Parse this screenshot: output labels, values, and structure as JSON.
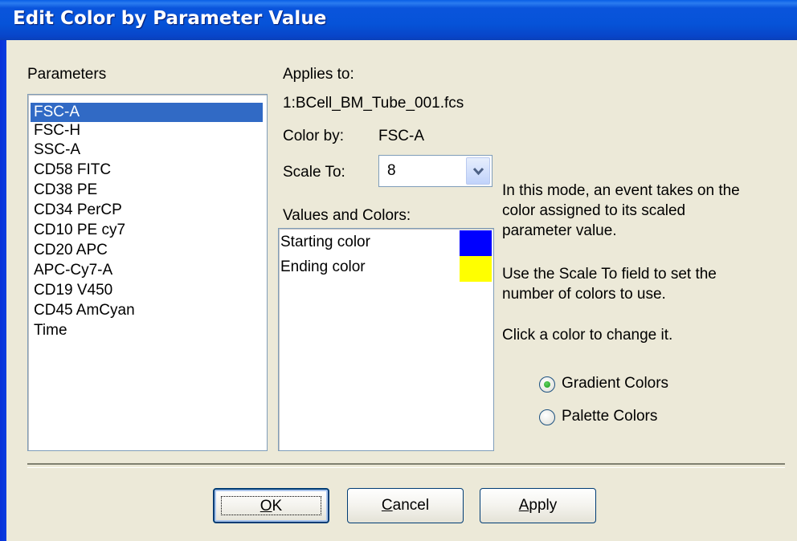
{
  "window": {
    "title": "Edit Color by Parameter Value"
  },
  "parameters": {
    "label": "Parameters",
    "items": [
      "FSC-A",
      "FSC-H",
      "SSC-A",
      "CD58 FITC",
      "CD38 PE",
      "CD34 PerCP",
      "CD10 PE cy7",
      "CD20 APC",
      "APC-Cy7-A",
      "CD19 V450",
      "CD45 AmCyan",
      "Time"
    ],
    "selected": "FSC-A"
  },
  "applies_to": {
    "label": "Applies to:",
    "value": "1:BCell_BM_Tube_001.fcs"
  },
  "color_by": {
    "label": "Color by:",
    "value": "FSC-A"
  },
  "scale_to": {
    "label": "Scale To:",
    "value": "8"
  },
  "values_colors": {
    "label": "Values and Colors:",
    "rows": [
      {
        "label": "Starting color",
        "color": "#0000ff"
      },
      {
        "label": "Ending color",
        "color": "#ffff00"
      }
    ]
  },
  "help": {
    "line1": "In this mode, an event takes on the",
    "line2": "color assigned to its scaled",
    "line3": "parameter value.",
    "line4": "Use the Scale To field to set the",
    "line5": "number of colors to use.",
    "line6": "Click a color to change it."
  },
  "mode": {
    "options": [
      "Gradient Colors",
      "Palette Colors"
    ],
    "selected": "Gradient Colors"
  },
  "buttons": {
    "ok_mnemonic": "O",
    "ok_rest": "K",
    "cancel_mnemonic": "C",
    "cancel_rest": "ancel",
    "apply_mnemonic": "A",
    "apply_rest": "pply"
  },
  "colors": {
    "title_bar": "#0653d8",
    "selection": "#316ac5",
    "dialog_bg": "#ece9d8"
  }
}
